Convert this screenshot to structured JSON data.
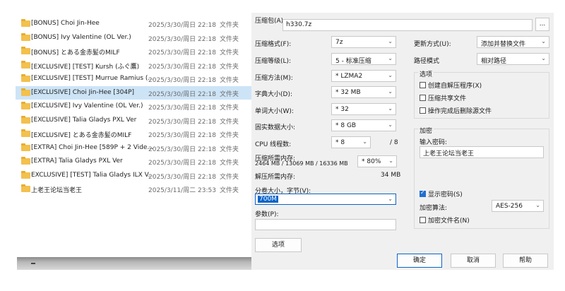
{
  "files": [
    {
      "name": "[BONUS] Choi Jin-Hee",
      "date": "2025/3/30/周日 22:18",
      "type": "文件夹"
    },
    {
      "name": "[BONUS] Ivy Valentine (OL Ver.)",
      "date": "2025/3/30/周日 22:18",
      "type": "文件夹"
    },
    {
      "name": "[BONUS] とある金赤髪のMILF",
      "date": "2025/3/30/周日 22:18",
      "type": "文件夹"
    },
    {
      "name": "[EXCLUSIVE] [TEST] Kursh (ふぐ鷹)",
      "date": "2025/3/30/周日 22:18",
      "type": "文件夹"
    },
    {
      "name": "[EXCLUSIVE] [TEST] Murrue Ramius (...",
      "date": "2025/3/30/周日 22:18",
      "type": "文件夹"
    },
    {
      "name": "[EXCLUSIVE] Choi Jin-Hee [304P]",
      "date": "2025/3/30/周日 22:18",
      "type": "文件夹",
      "selected": true
    },
    {
      "name": "[EXCLUSIVE] Ivy Valentine (OL Ver.)",
      "date": "2025/3/30/周日 22:18",
      "type": "文件夹"
    },
    {
      "name": "[EXCLUSIVE] Talia Gladys PXL Ver",
      "date": "2025/3/30/周日 22:18",
      "type": "文件夹"
    },
    {
      "name": "[EXCLUSIVE] とある金赤髪のMILF",
      "date": "2025/3/30/周日 22:18",
      "type": "文件夹"
    },
    {
      "name": "[EXTRA] Choi Jin-Hee [589P + 2 Vide...",
      "date": "2025/3/30/周日 22:18",
      "type": "文件夹"
    },
    {
      "name": "[EXTRA] Talia Gladys PXL Ver",
      "date": "2025/3/30/周日 22:18",
      "type": "文件夹"
    },
    {
      "name": "EXCLUSIVE] [TEST] Talia Gladys ILX V...",
      "date": "2025/3/30/周日 22:18",
      "type": "文件夹"
    },
    {
      "name": "上老王论坛当老王",
      "date": "2025/3/11/周二 23:53",
      "type": "文件夹"
    }
  ],
  "dialog": {
    "archive_label": "压缩包(A)",
    "archive_value": "h330.7z",
    "browse_label": "...",
    "format_label": "压缩格式(F):",
    "format_value": "7z",
    "level_label": "压缩等级(L):",
    "level_value": "5 - 标准压缩",
    "method_label": "压缩方法(M):",
    "method_value": "* LZMA2",
    "dict_label": "字典大小(D):",
    "dict_value": "* 32 MB",
    "word_label": "单词大小(W):",
    "word_value": "* 32",
    "solid_label": "固实数据大小:",
    "solid_value": "* 8 GB",
    "threads_label": "CPU 线程数:",
    "threads_value": "* 8",
    "threads_max": "/ 8",
    "mem_label": "压缩所需内存:",
    "mem_detail": "2464 MB / 13069 MB / 16336 MB",
    "mem_percent": "* 80%",
    "decomp_label": "解压所需内存:",
    "decomp_value": "34 MB",
    "split_label": "分卷大小，字节(V):",
    "split_value": "700M",
    "params_label": "参数(P):",
    "params_value": "",
    "options_button": "选项",
    "update_label": "更新方式(U):",
    "update_value": "添加并替换文件",
    "path_label": "路径模式",
    "path_value": "相对路径",
    "options_group": "选项",
    "opt_sfx": "创建自解压程序(X)",
    "opt_shared": "压缩共享文件",
    "opt_delete": "操作完成后删除源文件",
    "encrypt_group": "加密",
    "password_label": "输入密码:",
    "password_value": "上老王论坛当老王",
    "show_password": "显示密码(S)",
    "enc_method_label": "加密算法:",
    "enc_method_value": "AES-256",
    "enc_names": "加密文件名(N)",
    "ok_button": "确定",
    "cancel_button": "取消",
    "help_button": "帮助"
  }
}
